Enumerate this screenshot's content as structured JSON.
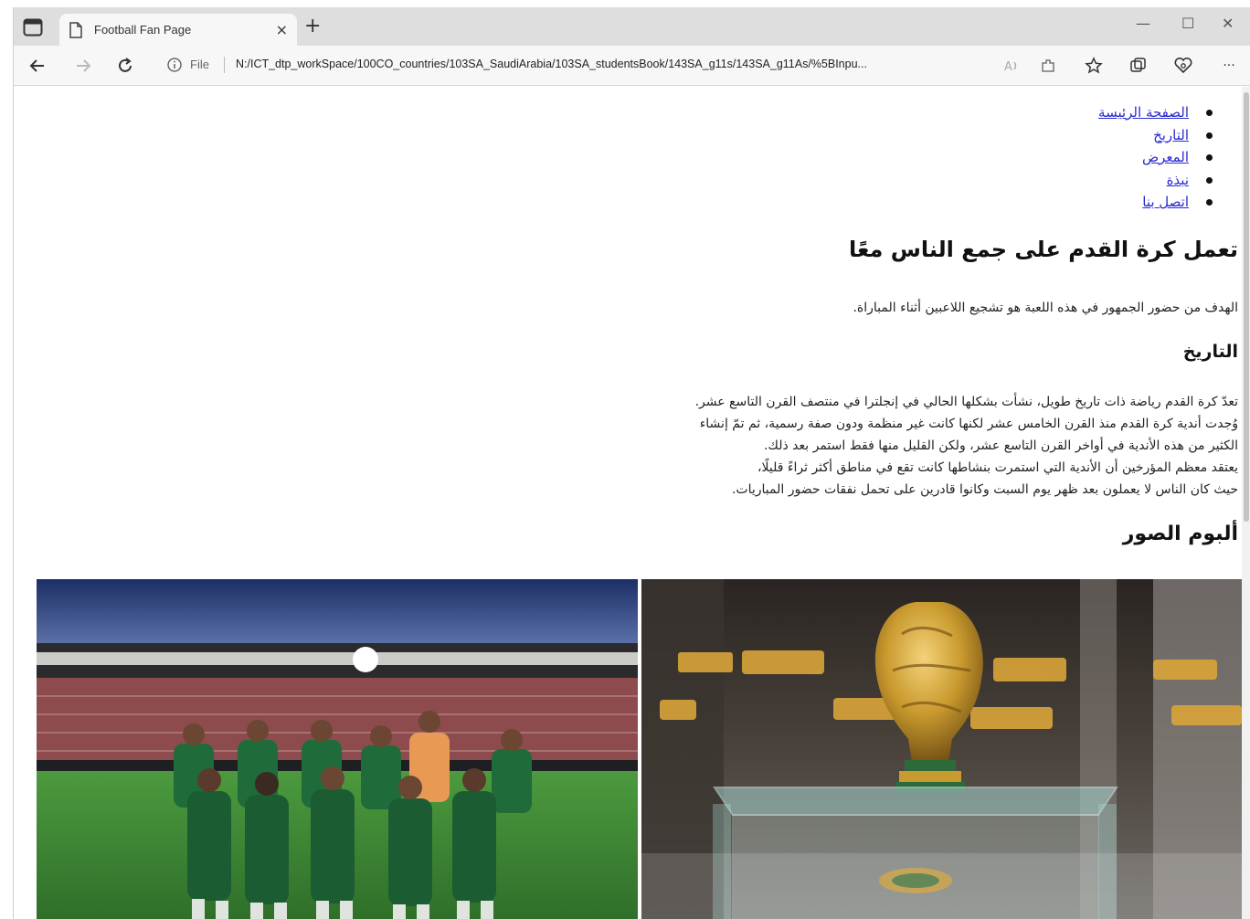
{
  "browser": {
    "tab_title": "Football Fan Page",
    "tab_close": "×",
    "new_tab": "+",
    "minimize": "—",
    "maximize": "☐",
    "close": "✕",
    "file_label": "File",
    "url": "N:/ICT_dtp_workSpace/100CO_countries/103SA_SaudiArabia/103SA_studentsBook/143SA_g11s/143SA_g11As/%5BInpu...",
    "more": "···"
  },
  "nav": {
    "items": [
      {
        "label": "الصفحة الرئيسة"
      },
      {
        "label": "التاريخ"
      },
      {
        "label": "المعرض"
      },
      {
        "label": "نبذة"
      },
      {
        "label": "اتصل بنا"
      }
    ]
  },
  "main": {
    "heading": "تعمل كرة القدم على جمع الناس معًا",
    "intro": "الهدف من حضور الجمهور في هذه اللعبة هو تشجيع اللاعبين أثناء المباراة.",
    "history_heading": "التاريخ",
    "history_lines": [
      "تعدّ كرة القدم رياضة ذات تاريخ طويل، نشأت بشكلها الحالي في إنجلترا في منتصف القرن التاسع عشر.",
      "وُجدت أندية كرة القدم منذ القرن الخامس عشر لكنها كانت غير منظمة ودون صفة رسمية، ثم تمّ إنشاء",
      "الكثير من هذه الأندية في أواخر القرن التاسع عشر، ولكن القليل منها فقط استمر بعد ذلك.",
      "يعتقد معظم المؤرخين أن الأندية التي استمرت بنشاطها كانت تقع في مناطق أكثر ثراءً قليلًا،",
      "حيث كان الناس لا يعملون بعد ظهر يوم السبت وكانوا قادرين على تحمل نفقات حضور المباريات."
    ],
    "album_heading": "ألبوم الصور"
  },
  "icons": {
    "sidebar": "sidebar-toggle-icon",
    "page": "page-icon",
    "back": "back-arrow-icon",
    "forward": "forward-arrow-icon",
    "refresh": "refresh-icon",
    "info": "info-icon",
    "read_aloud": "read-aloud-icon",
    "extensions": "extensions-icon",
    "favorites": "favorites-star-icon",
    "collections": "collections-icon",
    "profile": "profile-heart-icon"
  },
  "colors": {
    "link": "#2a2ad0",
    "team_kit": "#1f6b3a",
    "pitch": "#3d8a34",
    "trophy_gold": "#c99a2e"
  }
}
